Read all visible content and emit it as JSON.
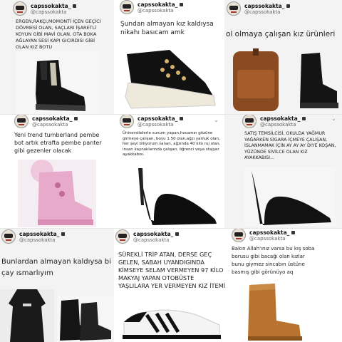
{
  "account": {
    "username": "capssokakta_",
    "handle": "@capssokakta"
  },
  "icons": {
    "avatar": "avatar-icon",
    "lock": "lock-icon",
    "chevron": "chevron-down-icon"
  },
  "tweets": [
    {
      "id": "t1",
      "text": "ERGEN,RAKÇI,MOMONTİ İÇEN GEÇİCİ DÖVMESİ OLAN, SAÇLARI İŞARETLİ KOYUN GİBİ MAVİ OLAN, OTA BOKA AĞLAYAN SESİ KAPI GICIRDISI GİBİ OLAN KIZ BOTU"
    },
    {
      "id": "t2",
      "text": "Şundan almayan kız kaldıysa nikahı basıcam amk"
    },
    {
      "id": "t3",
      "text": "ol olmaya çalışan kız ürünleri"
    },
    {
      "id": "t4",
      "text": "Yeni trend tumberland pembe bot artık etrafta pembe panter gibi gezenler olacak"
    },
    {
      "id": "t5",
      "text": "Üniversitelerle sunum yapan,hocamın gözüne girmeye çalışan, boyu 1.50 olan,ağzı yamuk olan, her şeyi biliyorum sanan, ağzında 40 kilo ruj olan, insan kaynaklarında çalışan, öğrenci veya stajyer ayakkabısı."
    },
    {
      "id": "t6",
      "text": "SATIŞ TEMSİLCİSİ, OKULDA YAĞMUR YAĞARKEN SİGARA İÇMEYE ÇALIŞAN, İSLANMAMAK İÇİN AY AY AY DİYE KOŞAN, YÜZÜNDE SİVİLCE OLAN KIZ AYAKKABISI..."
    },
    {
      "id": "t7",
      "text": "Bunlardan almayan kaldıysa bi çay ısmarlıyım"
    },
    {
      "id": "t8",
      "text": "SÜREKLİ TRİP ATAN, DERSE GEÇ GELEN, SABAH UYANDIGINDA KİMSEYE SELAM VERMEYEN 97 KİLO MAKYAJ YAPAN OTOBÜSTE YAŞLILARA YER VERMEYEN KIZ İTEMİ"
    },
    {
      "id": "t9",
      "text": "Bakın Allah'ınız varsa bu kış soba borusu gibi bacağı olan kızlar bunu giymez sincabın üstüne basmış gibi görünüyo aq"
    }
  ]
}
